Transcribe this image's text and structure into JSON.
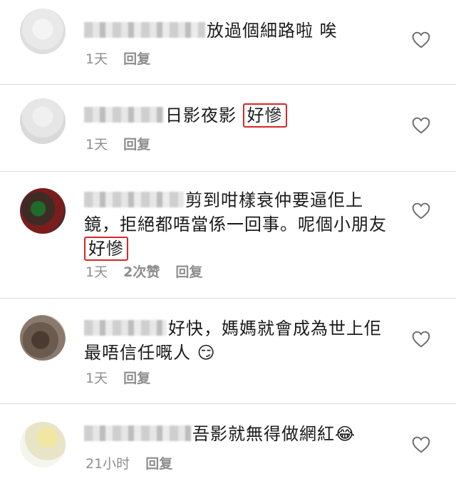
{
  "comments": [
    {
      "text": "放過個細路啦 唉",
      "highlight": "",
      "time": "1天",
      "likes": "",
      "reply": "回复"
    },
    {
      "text": "日影夜影",
      "highlight": "好慘",
      "time": "1天",
      "likes": "",
      "reply": "回复"
    },
    {
      "text_line1": "剪到咁樣衰仲要逼佢上",
      "text_line2": "鏡，拒絕都唔當係一回事。呢個小朋友",
      "highlight": "好慘",
      "time": "1天",
      "likes": "2次赞",
      "reply": "回复"
    },
    {
      "text_line1": "好快，媽媽就會成為世上佢",
      "text_line2": "最唔信任嘅人",
      "emoji": "😏",
      "time": "1天",
      "likes": "",
      "reply": "回复"
    },
    {
      "text": "吾影就無得做網紅",
      "emoji": "😂",
      "time": "21小时",
      "likes": "",
      "reply": "回复"
    }
  ],
  "icons": {
    "like": "heart-outline-icon"
  },
  "colors": {
    "highlight_border": "#d9262b",
    "meta_text": "#8e8e8e"
  }
}
